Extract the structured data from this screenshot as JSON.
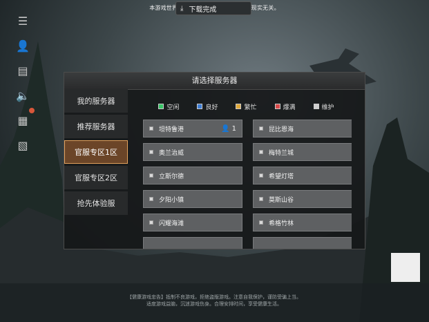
{
  "notice": {
    "text": "本游戏世界观、人物、情节均为虚构，与现实无关。",
    "download_label": "下载完成"
  },
  "side_icons": [
    "list-icon",
    "user-icon",
    "store-icon",
    "speaker-icon",
    "calendar-icon",
    "clipboard-icon"
  ],
  "dialog": {
    "title": "请选择服务器",
    "tabs": [
      "我的服务器",
      "推荐服务器",
      "官服专区1区",
      "官服专区2区",
      "抢先体验服"
    ],
    "legend": [
      {
        "label": "空闲",
        "color": "#39c567"
      },
      {
        "label": "良好",
        "color": "#3f7fd6"
      },
      {
        "label": "繁忙",
        "color": "#e0a93a"
      },
      {
        "label": "爆满",
        "color": "#d84a4a"
      },
      {
        "label": "维护",
        "color": "#cfcfcf"
      }
    ],
    "servers": [
      {
        "name": "坦特鲁港",
        "users": "1"
      },
      {
        "name": "昆比恩海"
      },
      {
        "name": "奥兰治威"
      },
      {
        "name": "梅特兰城"
      },
      {
        "name": "立斯尔德"
      },
      {
        "name": "希望灯塔"
      },
      {
        "name": "夕阳小镇"
      },
      {
        "name": "莫斯山谷"
      },
      {
        "name": "闪耀海滩"
      },
      {
        "name": "希格竹林"
      }
    ]
  },
  "footer": {
    "line1": "【健康游戏忠告】抵制不良游戏，拒绝盗版游戏。注意自我保护，谨防受骗上当。",
    "line2": "适度游戏益脑，沉迷游戏伤身。合理安排时间，享受健康生活。"
  }
}
